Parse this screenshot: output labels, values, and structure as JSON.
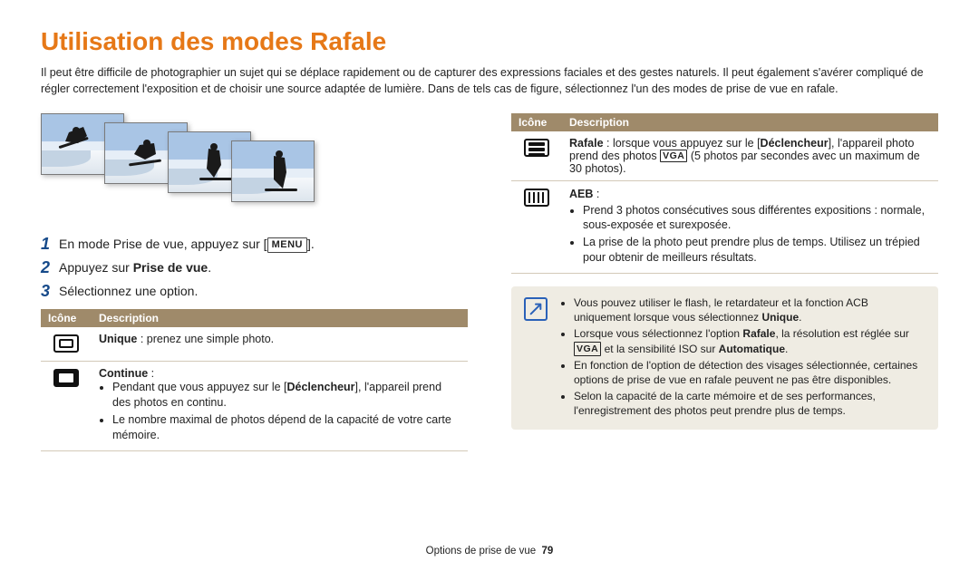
{
  "title": "Utilisation des modes Rafale",
  "intro": "Il peut être difficile de photographier un sujet qui se déplace rapidement ou de capturer des expressions faciales et des gestes naturels. Il peut également s'avérer compliqué de régler correctement l'exposition et de choisir une source adaptée de lumière. Dans de tels cas de figure, sélectionnez l'un des modes de prise de vue en rafale.",
  "menu_button": "MENU",
  "steps": {
    "s1": "En mode Prise de vue, appuyez sur [",
    "s1b": "].",
    "s2a": "Appuyez sur ",
    "s2b": "Prise de vue",
    "s2c": ".",
    "s3": "Sélectionnez une option."
  },
  "headers": {
    "icon": "Icône",
    "desc": "Description"
  },
  "left_table": {
    "r1": {
      "label": "Unique",
      "text": " : prenez une simple photo."
    },
    "r2": {
      "label": "Continue",
      "text": " :",
      "b1a": "Pendant que vous appuyez sur le [",
      "b1bold": "Déclencheur",
      "b1b": "], l'appareil prend des photos en continu.",
      "b2": "Le nombre maximal de photos dépend de la capacité de votre carte mémoire."
    }
  },
  "right_table": {
    "r1": {
      "label": "Rafale",
      "a": " : lorsque vous appuyez sur le [",
      "bold1": "Déclencheur",
      "b": "], l'appareil photo prend des photos ",
      "vga": "VGA",
      "c": " (5 photos par secondes avec un maximum de 30 photos)."
    },
    "r2": {
      "label": "AEB",
      "text": " :",
      "b1": "Prend 3 photos consécutives sous différentes expositions : normale, sous-exposée et surexposée.",
      "b2": "La prise de la photo peut prendre plus de temps. Utilisez un trépied pour obtenir de meilleurs résultats."
    }
  },
  "notes": {
    "n1a": "Vous pouvez utiliser le flash, le retardateur et la fonction ACB uniquement lorsque vous sélectionnez ",
    "n1bold": "Unique",
    "n1b": ".",
    "n2a": "Lorsque vous sélectionnez l'option ",
    "n2bold1": "Rafale",
    "n2b": ", la résolution est réglée sur ",
    "n2vga": "VGA",
    "n2c": " et la sensibilité ISO sur ",
    "n2bold2": "Automatique",
    "n2d": ".",
    "n3": "En fonction de l'option de détection des visages sélectionnée, certaines options de prise de vue en rafale peuvent ne pas être disponibles.",
    "n4": "Selon la capacité de la carte mémoire et de ses performances, l'enregistrement des photos peut prendre plus de temps."
  },
  "footer": {
    "label": "Options de prise de vue",
    "page": "79"
  }
}
